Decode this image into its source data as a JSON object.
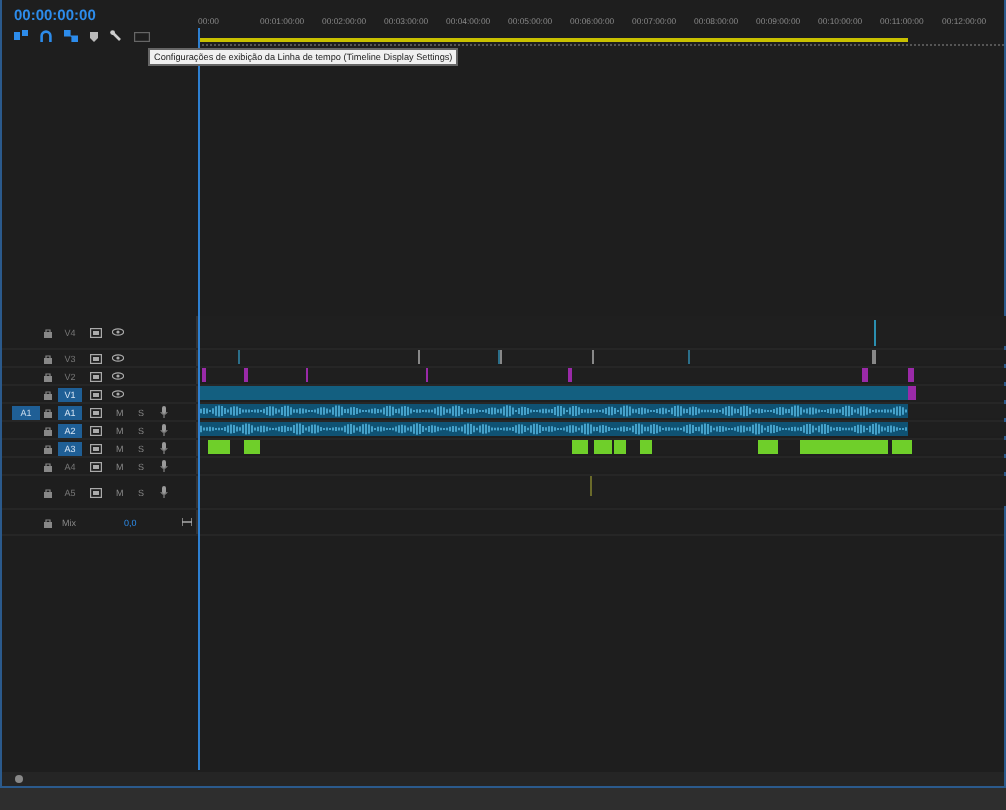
{
  "timecode": "00:00:00:00",
  "tooltip": "Configurações de exibição da Linha de tempo (Timeline Display Settings)",
  "ruler": {
    "labels": [
      "00:00",
      "00:01:00:00",
      "00:02:00:00",
      "00:03:00:00",
      "00:04:00:00",
      "00:05:00:00",
      "00:06:00:00",
      "00:07:00:00",
      "00:08:00:00",
      "00:09:00:00",
      "00:10:00:00",
      "00:11:00:00",
      "00:12:00:00"
    ],
    "level": 0.88
  },
  "tracks": [
    {
      "kind": "video",
      "label": "V4",
      "targeted": false,
      "tall": true
    },
    {
      "kind": "video",
      "label": "V3",
      "targeted": false,
      "tall": false
    },
    {
      "kind": "video",
      "label": "V2",
      "targeted": false,
      "tall": false
    },
    {
      "kind": "video",
      "label": "V1",
      "targeted": true,
      "tall": false
    },
    {
      "kind": "audio",
      "label": "A1",
      "targeted": true,
      "tall": false,
      "source": "A1",
      "mute": "M",
      "solo": "S"
    },
    {
      "kind": "audio",
      "label": "A2",
      "targeted": true,
      "tall": false,
      "mute": "M",
      "solo": "S"
    },
    {
      "kind": "audio",
      "label": "A3",
      "targeted": true,
      "tall": false,
      "mute": "M",
      "solo": "S"
    },
    {
      "kind": "audio",
      "label": "A4",
      "targeted": false,
      "tall": false,
      "mute": "M",
      "solo": "S"
    },
    {
      "kind": "audio",
      "label": "A5",
      "targeted": false,
      "tall": true,
      "mute": "M",
      "solo": "S"
    }
  ],
  "mix": {
    "label": "Mix",
    "value": "0,0"
  }
}
